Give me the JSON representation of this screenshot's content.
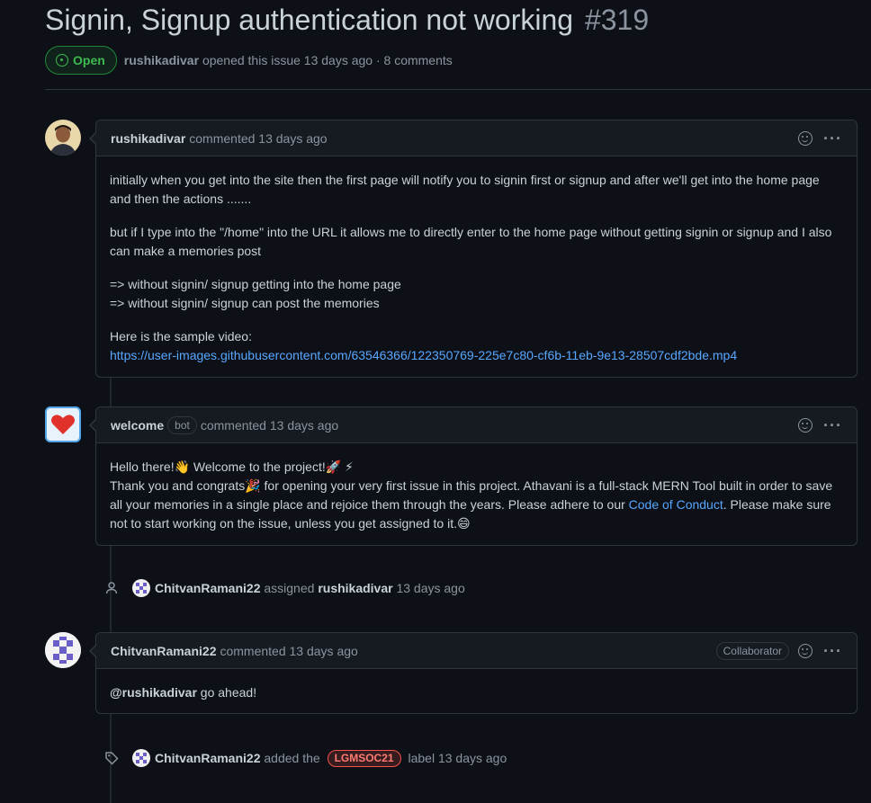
{
  "issue": {
    "title": "Signin, Signup authentication not working",
    "number": "#319",
    "state": "Open",
    "author": "rushikadivar",
    "opened_text": "opened this issue 13 days ago · 8 comments"
  },
  "comments": [
    {
      "author": "rushikadivar",
      "bot_badge": "",
      "action": "commented 13 days ago",
      "role_badge": "",
      "paragraphs": [
        "initially when you get into the site then the first page will notify you to signin first or signup and after we'll get into the home page and then the actions .......",
        "but if I type into the \"/home\" into the URL it allows me to directly enter to the home page without getting signin or signup and I also can make a memories post",
        "=> without signin/ signup getting into the home page",
        "=> without signin/ signup can post the memories",
        "Here is the sample video:"
      ],
      "link": "https://user-images.githubusercontent.com/63546366/122350769-225e7c80-cf6b-11eb-9e13-28507cdf2bde.mp4"
    },
    {
      "author": "welcome",
      "bot_badge": "bot",
      "action": "commented 13 days ago",
      "line1": "Hello there!👋 Welcome to the project!🚀 ⚡",
      "line2a": "Thank you and congrats🎉  for opening your very first issue in this project. Athavani is a full-stack MERN Tool built in order to save all your memories in a single place and rejoice them through the years. Please adhere to our ",
      "line2link": "Code of Conduct",
      "line2b": ". Please make sure not to start working on the issue, unless you get assigned to it.😄"
    },
    {
      "author": "ChitvanRamani22",
      "action": "commented 13 days ago",
      "role_badge": "Collaborator",
      "mention": "@rushikadivar",
      "body_rest": " go ahead!"
    }
  ],
  "events": [
    {
      "icon": "person-icon",
      "actor": "ChitvanRamani22",
      "verb": "assigned",
      "target": "rushikadivar",
      "time": "13 days ago"
    },
    {
      "icon": "tag-icon",
      "actor": "ChitvanRamani22",
      "verb": "added the",
      "label": "LGMSOC21",
      "suffix": "label",
      "time": "13 days ago"
    }
  ],
  "colors": {
    "background": "#0d1117",
    "open_green": "#3fb950",
    "link": "#58a6ff",
    "label_red": "#f85149"
  }
}
